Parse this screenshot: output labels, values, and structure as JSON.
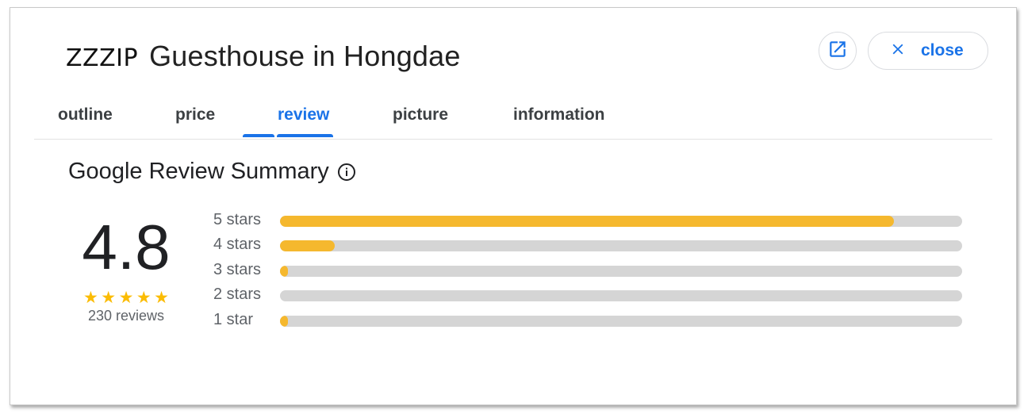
{
  "header": {
    "brand": "ZZZIP",
    "title": "Guesthouse in Hongdae",
    "open_icon": "open-in-new-icon",
    "close_icon": "close-icon",
    "close_label": "close"
  },
  "tabs": [
    {
      "label": "outline",
      "active": false
    },
    {
      "label": "price",
      "active": false
    },
    {
      "label": "review",
      "active": true
    },
    {
      "label": "picture",
      "active": false
    },
    {
      "label": "information",
      "active": false
    }
  ],
  "summary": {
    "title": "Google Review Summary",
    "info_icon": "info-icon",
    "score": "4.8",
    "star_count": 5,
    "review_count": "230 reviews"
  },
  "rating_bars": [
    {
      "label": "5 stars",
      "fraction": 0.9
    },
    {
      "label": "4 stars",
      "fraction": 0.08
    },
    {
      "label": "3 stars",
      "fraction": 0.012
    },
    {
      "label": "2 stars",
      "fraction": 0.0
    },
    {
      "label": "1 star",
      "fraction": 0.012
    }
  ],
  "colors": {
    "accent": "#1a73e8",
    "bar_fill": "#f5b82e",
    "bar_track": "#d5d5d5",
    "star": "#fbbc04"
  }
}
